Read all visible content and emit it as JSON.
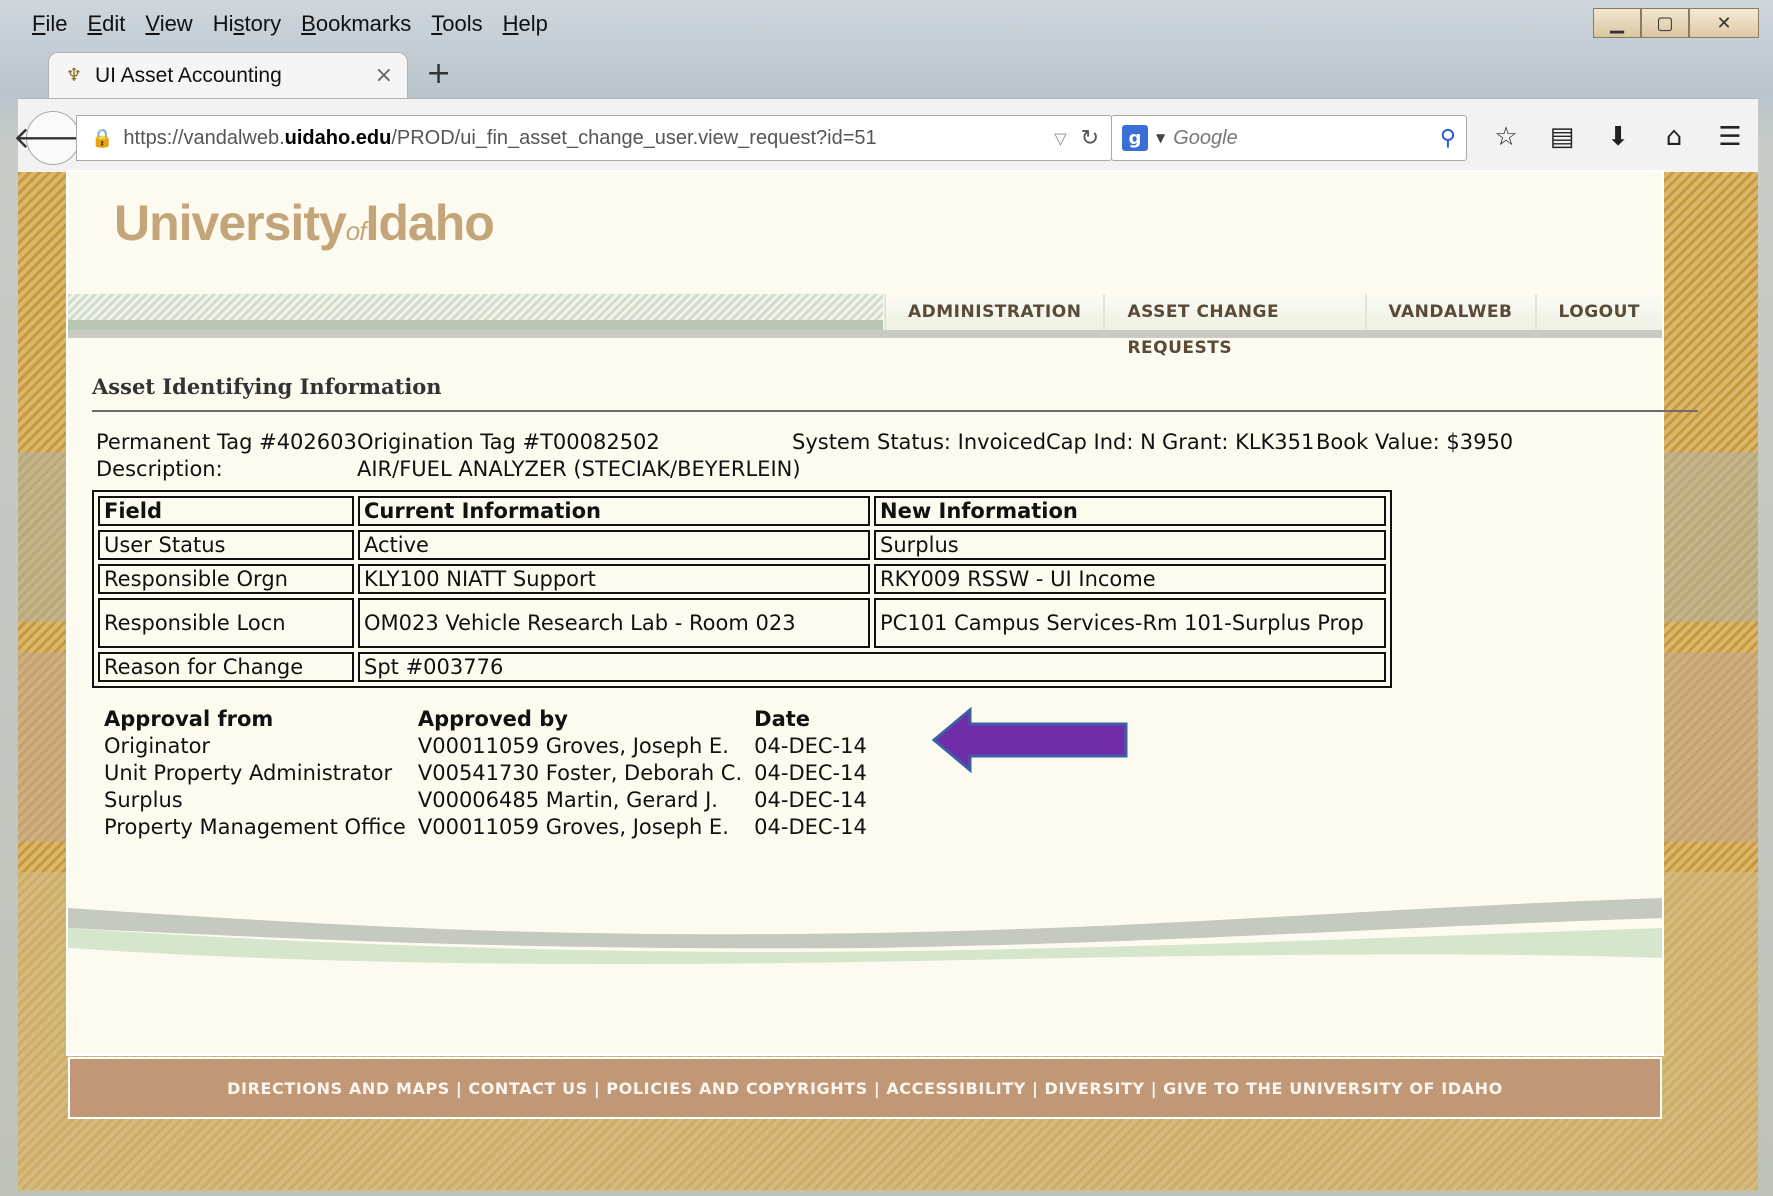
{
  "menu": [
    "File",
    "Edit",
    "View",
    "History",
    "Bookmarks",
    "Tools",
    "Help"
  ],
  "menu_underline": [
    "F",
    "E",
    "V",
    "s",
    "B",
    "T",
    "H"
  ],
  "tab": {
    "title": "UI Asset Accounting",
    "close": "×",
    "new": "+"
  },
  "address": {
    "prefix": "https://vandalweb.",
    "host": "uidaho.edu",
    "path": "/PROD/ui_fin_asset_change_user.view_request?id=51"
  },
  "search": {
    "placeholder": "Google"
  },
  "logo": {
    "main1": "University",
    "of": "of",
    "main2": "Idaho"
  },
  "site_nav": [
    "ADMINISTRATION",
    "ASSET CHANGE REQUESTS",
    "VANDALWEB",
    "LOGOUT"
  ],
  "section_title": "Asset Identifying Information",
  "asset": {
    "perm_tag": "Permanent Tag #402603",
    "orig_tag": "Origination Tag #T00082502",
    "status": "System Status: Invoiced",
    "cap": "Cap Ind: N",
    "grant": "Grant: KLK351",
    "book": "Book Value: $3950",
    "desc_label": "Description:",
    "desc": "AIR/FUEL ANALYZER (STECIAK/BEYERLEIN)"
  },
  "change_table": {
    "headers": [
      "Field",
      "Current Information",
      "New Information"
    ],
    "rows": [
      [
        "User Status",
        "Active",
        "Surplus"
      ],
      [
        "Responsible Orgn",
        "KLY100 NIATT Support",
        "RKY009 RSSW - UI Income"
      ],
      [
        "Responsible Locn",
        "OM023 Vehicle Research Lab - Room 023",
        "PC101 Campus Services-Rm 101-Surplus Prop"
      ],
      [
        "Reason for Change",
        "Spt #003776",
        ""
      ]
    ]
  },
  "approvals": {
    "headers": [
      "Approval from",
      "Approved by",
      "Date"
    ],
    "rows": [
      [
        "Originator",
        "V00011059 Groves, Joseph E.",
        "04-DEC-14"
      ],
      [
        "Unit Property Administrator",
        "V00541730 Foster, Deborah C.",
        "04-DEC-14"
      ],
      [
        "Surplus",
        "V00006485 Martin, Gerard J.",
        "04-DEC-14"
      ],
      [
        "Property Management Office",
        "V00011059 Groves, Joseph E.",
        "04-DEC-14"
      ]
    ]
  },
  "footer_links": [
    "DIRECTIONS AND MAPS",
    "CONTACT US",
    "POLICIES AND COPYRIGHTS",
    "ACCESSIBILITY",
    "DIVERSITY",
    "GIVE TO THE UNIVERSITY OF IDAHO"
  ],
  "colors": {
    "arrow": "#6f2da8",
    "footer": "#c09877",
    "logo": "#c4a57a"
  }
}
